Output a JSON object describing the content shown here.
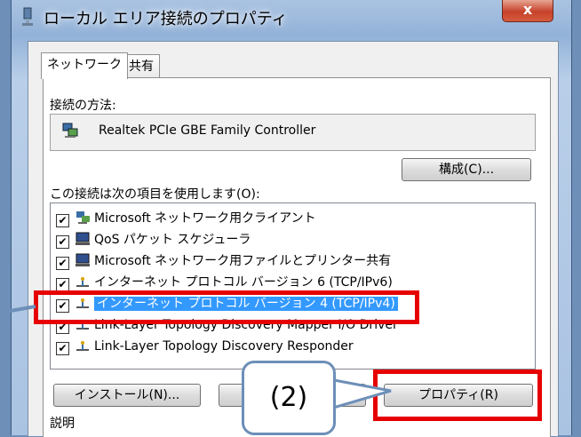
{
  "window": {
    "title": "ローカル エリア接続のプロパティ",
    "close": "x"
  },
  "tabs": [
    {
      "label": "ネットワーク"
    },
    {
      "label": "共有"
    }
  ],
  "connect_using_label": "接続の方法:",
  "adapter_name": "Realtek PCIe GBE Family Controller",
  "configure_button": "構成(C)...",
  "items_label": "この接続は次の項目を使用します(O):",
  "items": [
    {
      "label": "Microsoft ネットワーク用クライアント",
      "checked": "☑",
      "icon": "network-client-icon"
    },
    {
      "label": "QoS パケット スケジューラ",
      "checked": "☑",
      "icon": "computer-icon"
    },
    {
      "label": "Microsoft ネットワーク用ファイルとプリンター共有",
      "checked": "☑",
      "icon": "computer-icon"
    },
    {
      "label": "インターネット プロトコル バージョン 6 (TCP/IPv6)",
      "checked": "☑",
      "icon": "protocol-icon"
    },
    {
      "label": "インターネット プロトコル バージョン 4 (TCP/IPv4)",
      "checked": "☑",
      "icon": "protocol-icon",
      "selected": true
    },
    {
      "label": "Link-Layer Topology Discovery Mapper I/O Driver",
      "checked": "☑",
      "icon": "protocol-icon"
    },
    {
      "label": "Link-Layer Topology Discovery Responder",
      "checked": "☑",
      "icon": "protocol-icon"
    }
  ],
  "install_button": "インストール(N)...",
  "properties_button": "プロパティ(R)",
  "callout_text": "(2)",
  "description_label": "説明",
  "colors": {
    "highlight": "#e60000",
    "selection": "#3399ff",
    "callout_border": "#6d8fb8"
  }
}
